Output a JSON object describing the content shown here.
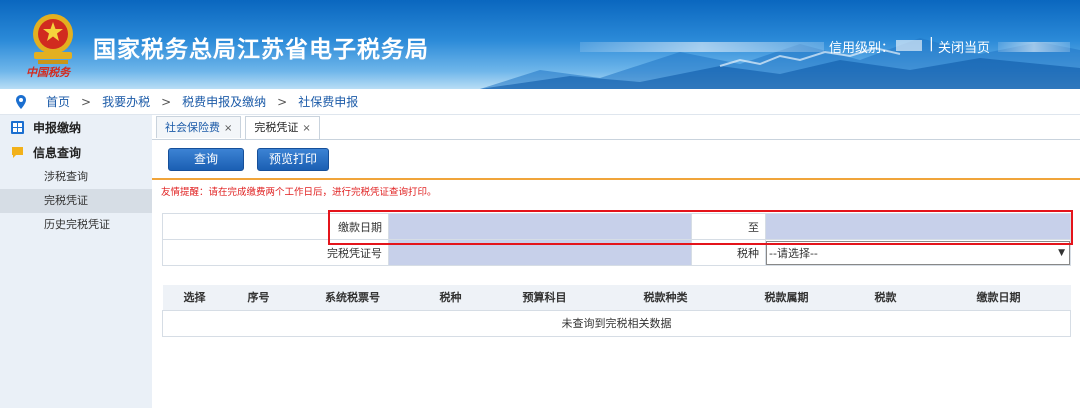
{
  "header": {
    "title": "国家税务总局江苏省电子税务局",
    "credit_label": "信用级别：",
    "separator": "|",
    "close_label": "关闭当页",
    "logo_text": "中国税务"
  },
  "breadcrumb": [
    "首页",
    "我要办税",
    "税费申报及缴纳",
    "社保费申报"
  ],
  "breadcrumb_separator": ">",
  "sidebar": {
    "groups": [
      {
        "label": "申报缴纳",
        "icon": "grid-icon"
      },
      {
        "label": "信息查询",
        "icon": "chat-bubble-icon"
      }
    ],
    "items": [
      "涉税查询",
      "完税凭证",
      "历史完税凭证"
    ],
    "active_item": "完税凭证"
  },
  "tabs": [
    {
      "label": "社会保险费",
      "close": "×"
    },
    {
      "label": "完税凭证",
      "close": "×"
    }
  ],
  "buttons": {
    "query": "查询",
    "preview_print": "预览打印"
  },
  "tip": "友情提醒：请在完成缴费两个工作日后，进行完税凭证查询打印。",
  "form": {
    "payment_date_label": "缴款日期",
    "payment_date_from": "",
    "to_label": "至",
    "payment_date_to": "",
    "certificate_no_label": "完税凭证号",
    "certificate_no_value": "",
    "tax_type_label": "税种",
    "tax_type_selected": "--请选择--",
    "dropdown_arrow": "▼"
  },
  "result_table": {
    "columns": [
      "选择",
      "序号",
      "系统税票号",
      "税种",
      "预算科目",
      "税款种类",
      "税款属期",
      "税款",
      "缴款日期"
    ],
    "empty_message": "未查询到完税相关数据"
  },
  "colors": {
    "header_blue": "#0a67bf",
    "button_blue": "#1b5fb3",
    "tip_red": "#e02020",
    "highlight_red": "#e4141b",
    "input_fill": "#c7d0ea"
  }
}
